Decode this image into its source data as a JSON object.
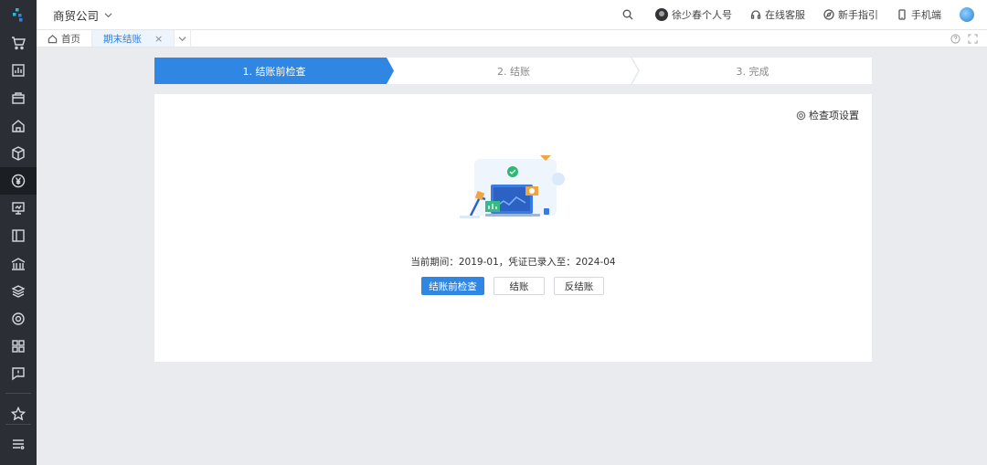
{
  "header": {
    "company": "商贸公司",
    "user": "徐少春个人号",
    "service": "在线客服",
    "guide": "新手指引",
    "mobile": "手机端"
  },
  "tabs": {
    "home": "首页",
    "active": "期末结账",
    "close": "×"
  },
  "steps": [
    "1. 结账前检查",
    "2. 结账",
    "3. 完成"
  ],
  "main": {
    "settings_label": "检查项设置",
    "period_text": "当前期间：2019-01，凭证已录入至：2024-04",
    "buttons": {
      "precheck": "结账前检查",
      "close": "结账",
      "reverse": "反结账"
    }
  },
  "colors": {
    "primary": "#2f86e3",
    "sidebar": "#2b2f35",
    "background": "#e9ebee"
  }
}
